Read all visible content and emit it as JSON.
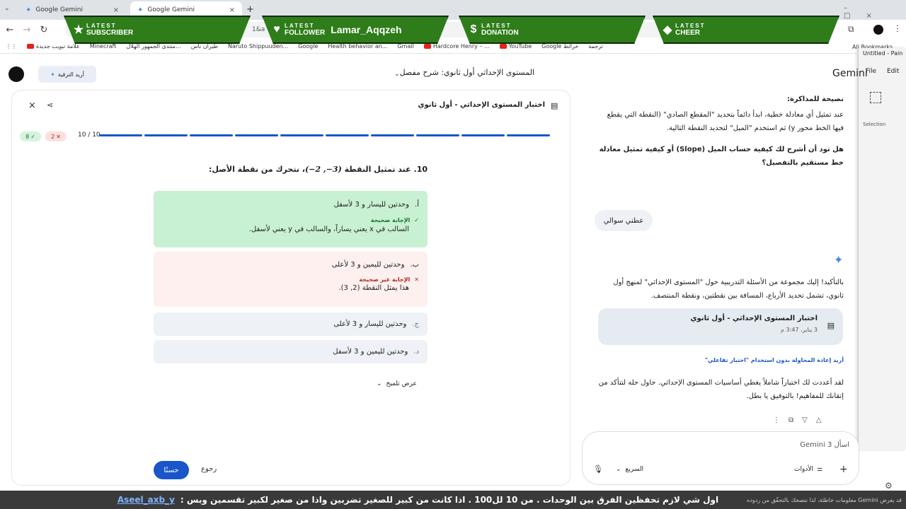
{
  "browser": {
    "tabs": [
      {
        "label": "Google Gemini",
        "active": false
      },
      {
        "label": "Google Gemini",
        "active": true
      }
    ],
    "new_tab": "+",
    "url_fragment": "1&a",
    "bookmarks": [
      "علامة تبويب جديدة",
      "Minecraft",
      "منتدى الجمهور الهلال...",
      "طيران ناس",
      "Naruto Shippuuden...",
      "Google",
      "Health behavior an...",
      "Gmail",
      "Hardcore Henry – ...",
      "YouTube",
      "Google خرائط",
      "ترجمة"
    ],
    "all_bookmarks": "All Bookmarks"
  },
  "overlay": {
    "subscriber": {
      "line1": "LATEST",
      "line2": "SUBSCRIBER"
    },
    "follower": {
      "line1": "LATEST",
      "line2": "FOLLOWER",
      "name": "Lamar_Aqqzeh"
    },
    "donation": {
      "line1": "LATEST",
      "line2": "DONATION"
    },
    "cheer": {
      "line1": "LATEST",
      "line2": "CHEER"
    }
  },
  "paint": {
    "title": "Untitled - Pain",
    "menu_file": "File",
    "menu_edit": "Edit",
    "tool_label": "Selection"
  },
  "header": {
    "logo": "Gemini",
    "conversation_title": "المستوى الإحداثي أول ثانوي: شرح مفصل",
    "upgrade_label": "أريد الترقية"
  },
  "quiz": {
    "title": "اختبار المستوى الإحداثي - أول ثانوي",
    "progress_text": "10 / 10",
    "progress_segments": 10,
    "wrong_count": "2",
    "correct_count": "8",
    "question_number": "10.",
    "question_text": "عند تمثيل النقطة",
    "question_point": "(3−, 2−)",
    "question_tail": "، نتحرك من نقطة الأصل:",
    "options": [
      {
        "letter": "أ.",
        "text": "وحدتين لليسار و 3 لأسفل",
        "state": "correct",
        "feedback_title": "الإجابة صحيحة",
        "feedback_text": "السالب في x يعني يساراً، والسالب في y يعني لأسفل."
      },
      {
        "letter": "ب.",
        "text": "وحدتين لليمين و 3 لأعلى",
        "state": "wrong",
        "feedback_title": "الإجابة غير صحيحة",
        "feedback_text": "هذا يمثل النقطة (2, 3)."
      },
      {
        "letter": "ج.",
        "text": "وحدتين لليسار و 3 لأعلى",
        "state": "neutral"
      },
      {
        "letter": "د.",
        "text": "وحدتين لليمين و 3 لأسفل",
        "state": "neutral"
      }
    ],
    "hint_label": "عرض تلميح",
    "done_label": "حسنًا",
    "back_label": "رجوع"
  },
  "chat": {
    "tip_heading": "نصيحة للمذاكرة:",
    "tip_text": "عند تمثيل أي معادلة خطية، ابدأ دائماً بتحديد \"المقطع الصادي\" (النقطة التي يقطع فيها الخط محور y) ثم استخدم \"الميل\" لتحديد النقطة التالية.",
    "question_bold": "هل تود أن أشرح لك كيفية حساب الميل (Slope) أو كيفية تمثيل معادلة خط مستقيم بالتفصيل؟",
    "user_message": "عطني سوالي",
    "reply_intro": "بالتأكيد! إليك مجموعة من الأسئلة التدريبية حول \"المستوى الإحداثي\" لمنهج أول ثانوي، تشمل تحديد الأرباع، المسافة بين نقطتين، ونقطة المنتصف.",
    "card_title": "اختبار المستوى الإحداثي - أول ثانوي",
    "card_date": "3 يناير، 3:47 م",
    "retry_link": "أريد إعادة المحاولة بدون استخدام \"اختبار تفاعلي\"",
    "closing_text": "لقد أعددت لك اختباراً شاملاً يغطي أساسيات المستوى الإحداثي. حاول حله لتتأكد من إتقانك للمفاهيم! بالتوفيق يا بطل."
  },
  "composer": {
    "placeholder": "اسأل Gemini 3",
    "tools_label": "الأدوات",
    "model_label": "السريع"
  },
  "disclaimer": "قد يعرض Gemini معلومات خاطئة، لذا ننصحك بالتحقّق من ردوده",
  "ticker": {
    "handle": "Aseel_axb_y",
    "text": "اول شي لازم تحفظين الفرق بين الوحدات . من 10 لل100 . اذا كانت من كبير للصغير تضربين واذا من صغير لكبير تقسمين وبس :"
  },
  "colors": {
    "accent": "#1a56c9",
    "correct_bg": "#c8f0d2",
    "wrong_bg": "#fdf0ef",
    "neutral_bg": "#eef1f5",
    "overlay_green": "#2e7d1a"
  }
}
